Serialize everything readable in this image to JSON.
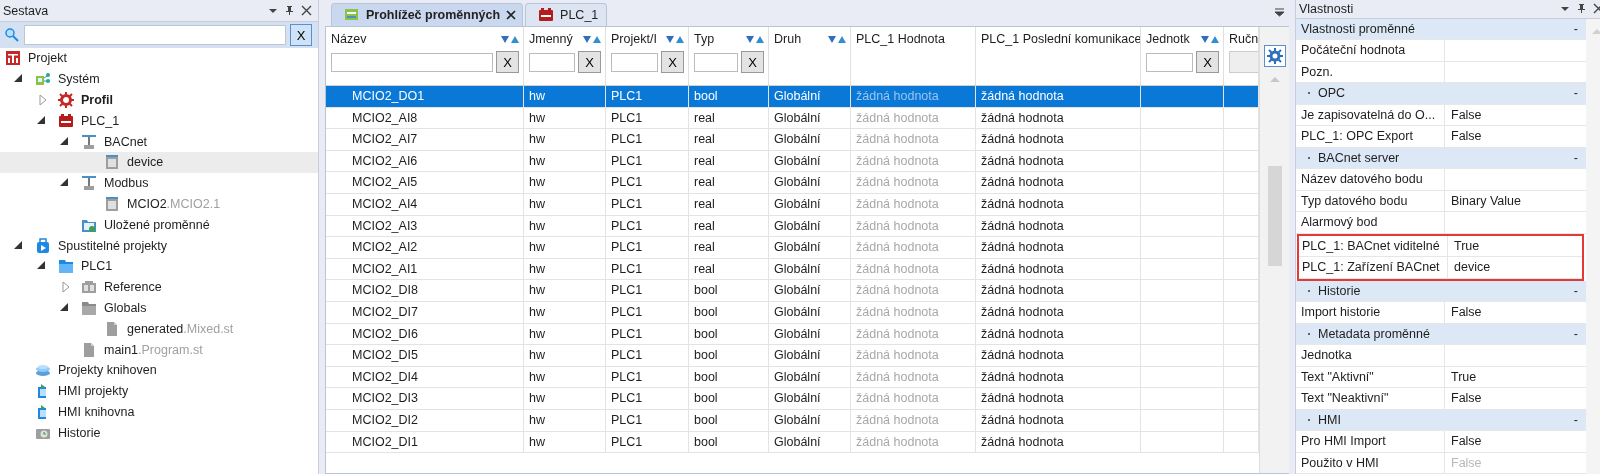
{
  "left_panel": {
    "title": "Sestava",
    "search": {
      "clear": "X"
    },
    "tree": [
      {
        "label": "Projekt",
        "kind": "root",
        "selected": false,
        "active": false
      },
      {
        "label": "Systém",
        "kind": "system",
        "expanded": true,
        "selected": false,
        "active": false,
        "children": [
          {
            "label": "Profil",
            "kind": "profile",
            "expanded": false,
            "selected": false,
            "active": true
          },
          {
            "label": "PLC_1",
            "kind": "plc",
            "expanded": true,
            "selected": false,
            "active": false,
            "children": [
              {
                "label": "BACnet",
                "kind": "bus",
                "expanded": true,
                "selected": false,
                "active": false,
                "children": [
                  {
                    "label": "device",
                    "kind": "module",
                    "selected": true,
                    "active": false
                  }
                ]
              },
              {
                "label": "Modbus",
                "kind": "bus",
                "expanded": true,
                "selected": false,
                "active": false,
                "children": [
                  {
                    "label": "MCIO2",
                    "suffix": ".MCIO2.1",
                    "kind": "module",
                    "selected": false,
                    "active": false
                  }
                ]
              },
              {
                "label": "Uložené proměnné",
                "kind": "saved",
                "selected": false,
                "active": false
              }
            ]
          }
        ]
      },
      {
        "label": "Spustitelné projekty",
        "kind": "runnable",
        "expanded": true,
        "selected": false,
        "active": false,
        "children": [
          {
            "label": "PLC1",
            "kind": "folder",
            "expanded": true,
            "selected": false,
            "active": false,
            "children": [
              {
                "label": "Reference",
                "kind": "reference",
                "expanded": false,
                "selected": false,
                "active": false
              },
              {
                "label": "Globals",
                "kind": "greyfolder",
                "expanded": true,
                "selected": false,
                "active": false,
                "children": [
                  {
                    "label": "generated",
                    "suffix": ".Mixed.st",
                    "kind": "file",
                    "selected": false,
                    "active": false
                  }
                ]
              },
              {
                "label": "main1",
                "suffix": ".Program.st",
                "kind": "file",
                "selected": false,
                "active": false
              }
            ]
          }
        ]
      },
      {
        "label": "Projekty knihoven",
        "kind": "library",
        "selected": false,
        "active": false
      },
      {
        "label": "HMI projekty",
        "kind": "hmi",
        "selected": false,
        "active": false
      },
      {
        "label": "HMI knihovna",
        "kind": "hmi",
        "selected": false,
        "active": false
      },
      {
        "label": "Historie",
        "kind": "history",
        "selected": false,
        "active": false
      }
    ]
  },
  "tabs": [
    {
      "label": "Prohlížeč proměnných",
      "kind": "viewer",
      "selected": true,
      "closable": true
    },
    {
      "label": "PLC_1",
      "kind": "plc",
      "selected": false,
      "closable": false
    }
  ],
  "grid": {
    "columns": [
      {
        "label": "Název",
        "sortable": true,
        "filter": "X"
      },
      {
        "label": "Jmenný",
        "sortable": true,
        "filter": "X"
      },
      {
        "label": "Projekt/I",
        "sortable": true,
        "filter": "X"
      },
      {
        "label": "Typ",
        "sortable": true,
        "filter": "X"
      },
      {
        "label": "Druh",
        "sortable": true
      },
      {
        "label": "PLC_1 Hodnota",
        "sortable": false
      },
      {
        "label": "PLC_1 Poslední komunikace",
        "sortable": false
      },
      {
        "label": "Jednotk",
        "sortable": true,
        "filter": "X"
      },
      {
        "label": "Ručn",
        "sortable": false,
        "button": true
      }
    ],
    "rows": [
      {
        "cells": [
          "MCIO2_DO1",
          "hw",
          "PLC1",
          "bool",
          "Globální",
          "žádná hodnota",
          "žádná hodnota"
        ],
        "selected": true
      },
      {
        "cells": [
          "MCIO2_AI8",
          "hw",
          "PLC1",
          "real",
          "Globální",
          "žádná hodnota",
          "žádná hodnota"
        ],
        "selected": false
      },
      {
        "cells": [
          "MCIO2_AI7",
          "hw",
          "PLC1",
          "real",
          "Globální",
          "žádná hodnota",
          "žádná hodnota"
        ],
        "selected": false
      },
      {
        "cells": [
          "MCIO2_AI6",
          "hw",
          "PLC1",
          "real",
          "Globální",
          "žádná hodnota",
          "žádná hodnota"
        ],
        "selected": false
      },
      {
        "cells": [
          "MCIO2_AI5",
          "hw",
          "PLC1",
          "real",
          "Globální",
          "žádná hodnota",
          "žádná hodnota"
        ],
        "selected": false
      },
      {
        "cells": [
          "MCIO2_AI4",
          "hw",
          "PLC1",
          "real",
          "Globální",
          "žádná hodnota",
          "žádná hodnota"
        ],
        "selected": false
      },
      {
        "cells": [
          "MCIO2_AI3",
          "hw",
          "PLC1",
          "real",
          "Globální",
          "žádná hodnota",
          "žádná hodnota"
        ],
        "selected": false
      },
      {
        "cells": [
          "MCIO2_AI2",
          "hw",
          "PLC1",
          "real",
          "Globální",
          "žádná hodnota",
          "žádná hodnota"
        ],
        "selected": false
      },
      {
        "cells": [
          "MCIO2_AI1",
          "hw",
          "PLC1",
          "real",
          "Globální",
          "žádná hodnota",
          "žádná hodnota"
        ],
        "selected": false
      },
      {
        "cells": [
          "MCIO2_DI8",
          "hw",
          "PLC1",
          "bool",
          "Globální",
          "žádná hodnota",
          "žádná hodnota"
        ],
        "selected": false
      },
      {
        "cells": [
          "MCIO2_DI7",
          "hw",
          "PLC1",
          "bool",
          "Globální",
          "žádná hodnota",
          "žádná hodnota"
        ],
        "selected": false
      },
      {
        "cells": [
          "MCIO2_DI6",
          "hw",
          "PLC1",
          "bool",
          "Globální",
          "žádná hodnota",
          "žádná hodnota"
        ],
        "selected": false
      },
      {
        "cells": [
          "MCIO2_DI5",
          "hw",
          "PLC1",
          "bool",
          "Globální",
          "žádná hodnota",
          "žádná hodnota"
        ],
        "selected": false
      },
      {
        "cells": [
          "MCIO2_DI4",
          "hw",
          "PLC1",
          "bool",
          "Globální",
          "žádná hodnota",
          "žádná hodnota"
        ],
        "selected": false
      },
      {
        "cells": [
          "MCIO2_DI3",
          "hw",
          "PLC1",
          "bool",
          "Globální",
          "žádná hodnota",
          "žádná hodnota"
        ],
        "selected": false
      },
      {
        "cells": [
          "MCIO2_DI2",
          "hw",
          "PLC1",
          "bool",
          "Globální",
          "žádná hodnota",
          "žádná hodnota"
        ],
        "selected": false
      },
      {
        "cells": [
          "MCIO2_DI1",
          "hw",
          "PLC1",
          "bool",
          "Globální",
          "žádná hodnota",
          "žádná hodnota"
        ],
        "selected": false
      }
    ]
  },
  "right_panel": {
    "title": "Vlastnosti",
    "groups": [
      {
        "title": "Vlastnosti proměnné",
        "toggle": "-",
        "bullet": false,
        "items": [
          {
            "name": "Počáteční hodnota",
            "highlighted": false
          },
          {
            "name": "Pozn.",
            "highlighted": false
          }
        ]
      },
      {
        "title": "OPC",
        "toggle": "-",
        "bullet": true,
        "items": [
          {
            "name": "Je zapisovatelná do O...",
            "value": "False",
            "highlighted": false,
            "disabled": false
          },
          {
            "name": "PLC_1: OPC Export",
            "value": "False",
            "highlighted": false,
            "disabled": false
          }
        ]
      },
      {
        "title": "BACnet server",
        "toggle": "-",
        "bullet": true,
        "items": [
          {
            "name": "Název datového bodu",
            "highlighted": false
          },
          {
            "name": "Typ datového bodu",
            "value": "Binary Value",
            "highlighted": false,
            "disabled": false
          },
          {
            "name": "Alarmový bod",
            "highlighted": false
          },
          {
            "name": "PLC_1: BACnet viditelné",
            "value": "True",
            "highlighted": true,
            "disabled": false
          },
          {
            "name": "PLC_1: Zařízení BACnet",
            "value": "device",
            "highlighted": true,
            "disabled": false
          }
        ]
      },
      {
        "title": "Historie",
        "toggle": "-",
        "bullet": true,
        "items": [
          {
            "name": "Import historie",
            "value": "False",
            "highlighted": false,
            "disabled": false
          }
        ]
      },
      {
        "title": "Metadata proměnné",
        "toggle": "-",
        "bullet": true,
        "items": [
          {
            "name": "Jednotka",
            "highlighted": false
          },
          {
            "name": "Text \"Aktivní\"",
            "value": "True",
            "highlighted": false,
            "disabled": false
          },
          {
            "name": "Text \"Neaktivní\"",
            "value": "False",
            "highlighted": false,
            "disabled": false
          }
        ]
      },
      {
        "title": "HMI",
        "toggle": "-",
        "bullet": true,
        "items": [
          {
            "name": "Pro HMI Import",
            "value": "False",
            "highlighted": false,
            "disabled": false
          },
          {
            "name": "Použito v HMI",
            "value": "False",
            "highlighted": false,
            "disabled": true
          }
        ]
      }
    ]
  }
}
